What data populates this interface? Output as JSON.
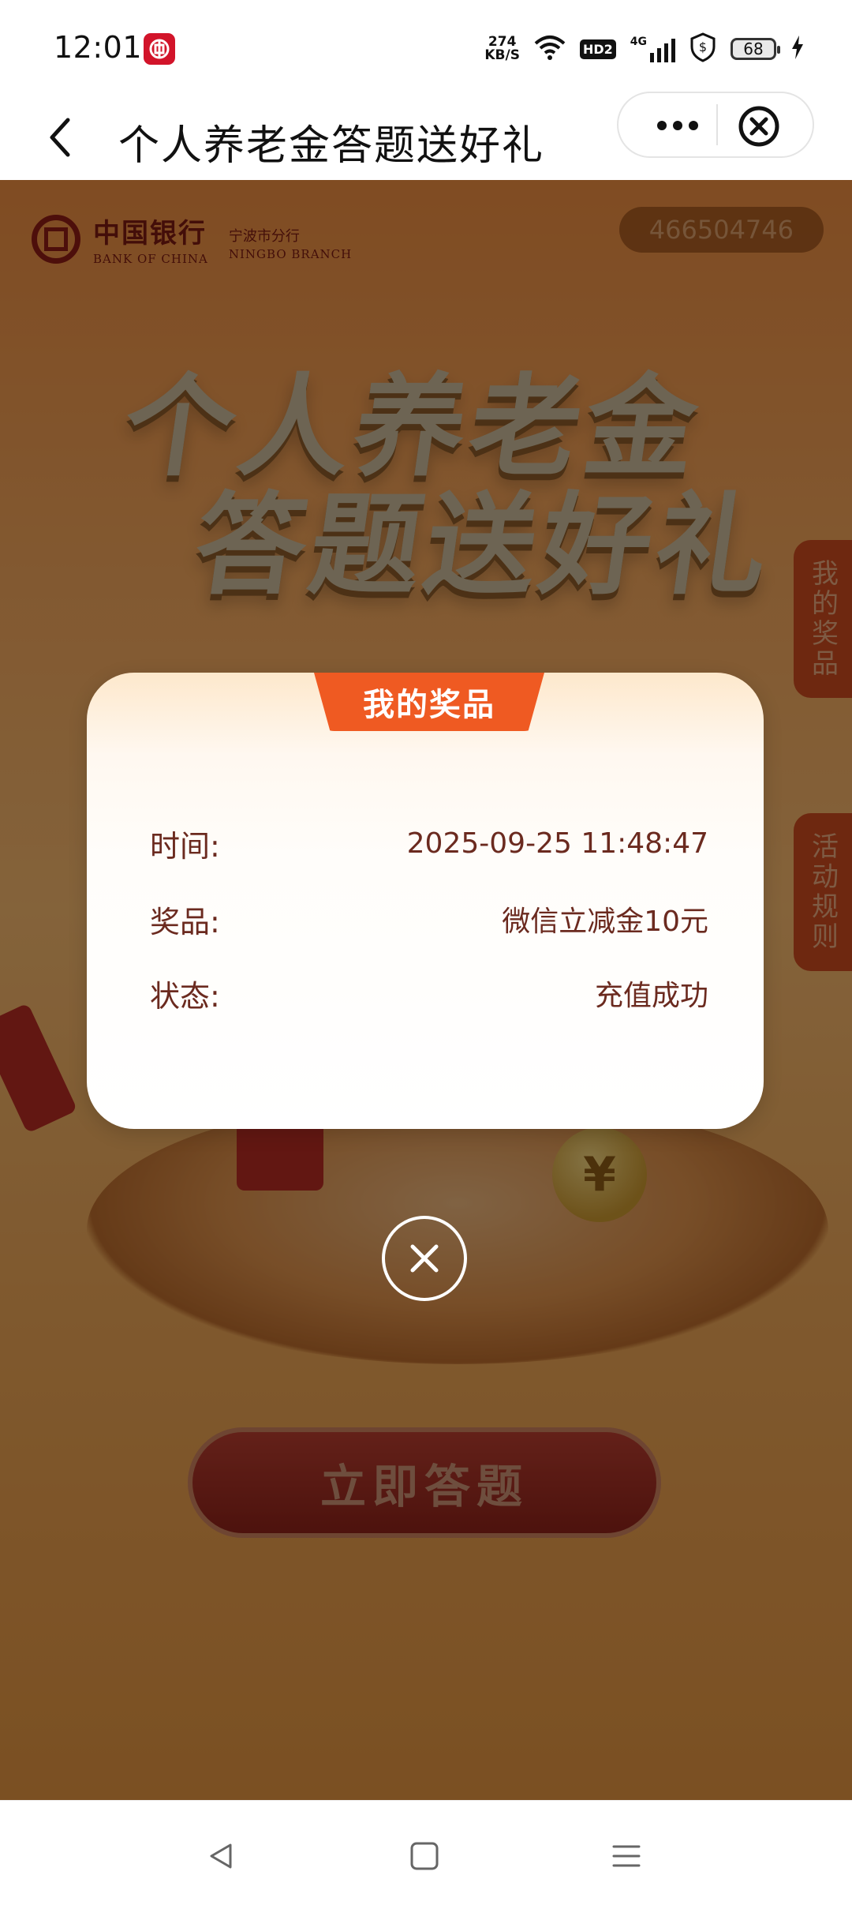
{
  "status_bar": {
    "time": "12:01",
    "net_speed_value": "274",
    "net_speed_unit": "KB/S",
    "hd_label": "HD2",
    "network_label": "4G",
    "battery": "68"
  },
  "titlebar": {
    "title": "个人养老金答题送好礼"
  },
  "page": {
    "bank_name_cn": "中国银行",
    "bank_name_en": "BANK OF CHINA",
    "branch_cn": "宁波市分行",
    "branch_en": "NINGBO BRANCH",
    "user_id": "466504746",
    "hero_line1": "个人养老金",
    "hero_line2": "答题送好礼",
    "tab_prize": "我的奖品",
    "tab_rules": "活动规则",
    "start_button": "立即答题",
    "coin_symbol": "¥"
  },
  "dialog": {
    "title": "我的奖品",
    "rows": [
      {
        "label": "时间:",
        "value": "2025-09-25 11:48:47"
      },
      {
        "label": "奖品:",
        "value": "微信立减金10元"
      },
      {
        "label": "状态:",
        "value": "充值成功"
      }
    ]
  },
  "colors": {
    "accent_orange": "#ef5a22",
    "text_brown": "#6b2a1f",
    "boc_red": "#8c1d14"
  }
}
